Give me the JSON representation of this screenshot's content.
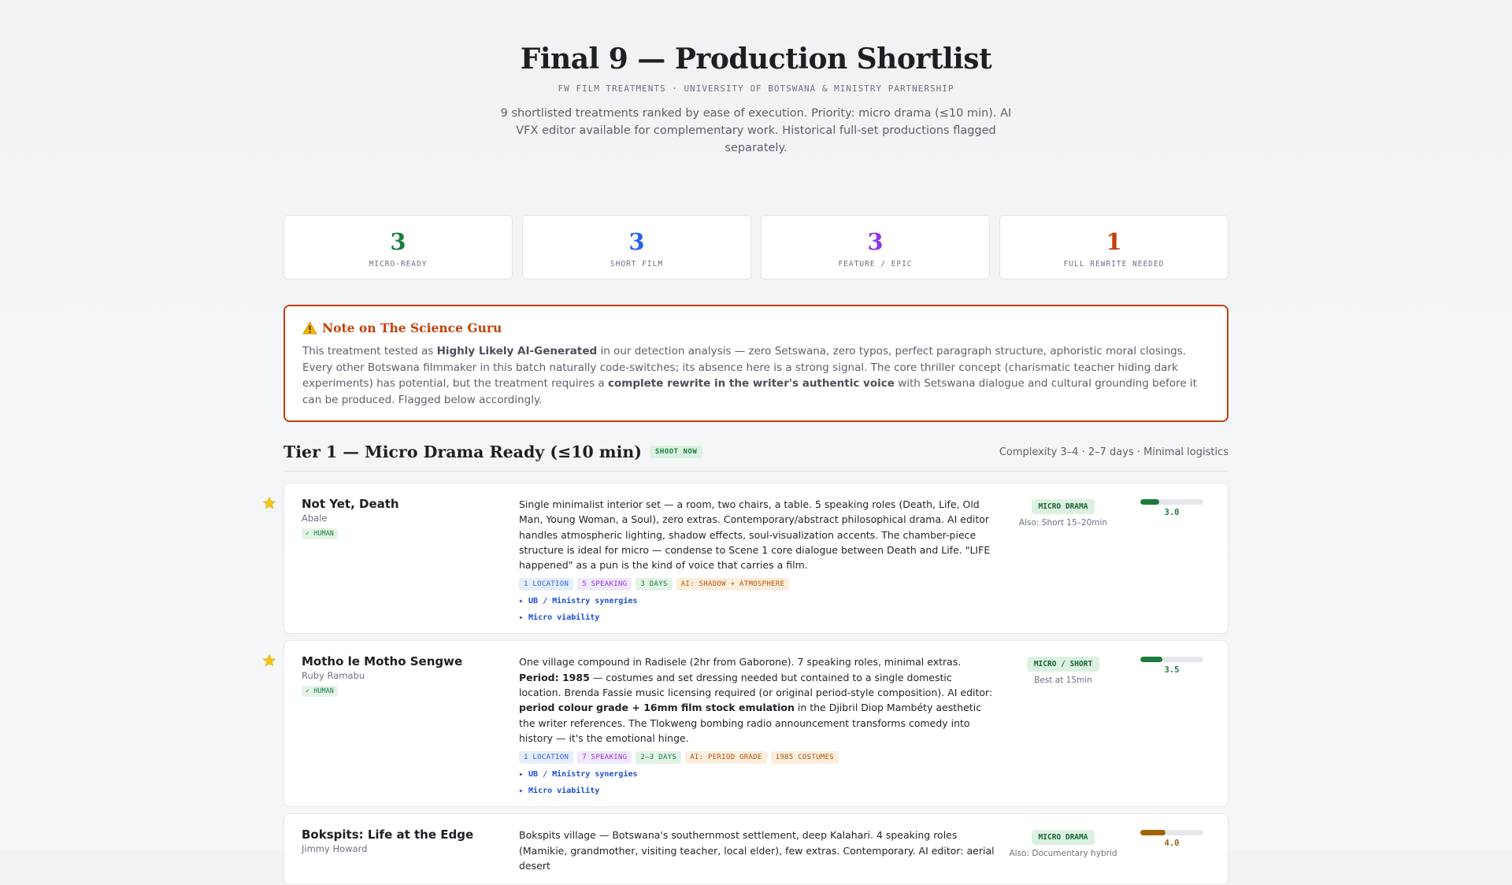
{
  "header": {
    "title": "Final 9 — Production Shortlist",
    "subtitle": "FW FILM TREATMENTS · UNIVERSITY OF BOTSWANA & MINISTRY PARTNERSHIP",
    "intro": "9 shortlisted treatments ranked by ease of execution. Priority: micro drama (≤10 min). AI VFX editor available for complementary work. Historical full-set productions flagged separately."
  },
  "stats": [
    {
      "value": "3",
      "label": "MICRO-READY",
      "color": "#15803d"
    },
    {
      "value": "3",
      "label": "SHORT FILM",
      "color": "#2563eb"
    },
    {
      "value": "3",
      "label": "FEATURE / EPIC",
      "color": "#9333ea"
    },
    {
      "value": "1",
      "label": "FULL REWRITE NEEDED",
      "color": "#c2410c"
    }
  ],
  "note": {
    "icon": "warning-icon",
    "title": "Note on The Science Guru",
    "p1": "This treatment tested as ",
    "b1": "Highly Likely AI-Generated",
    "p2": " in our detection analysis — zero Setswana, zero typos, perfect paragraph structure, aphoristic moral closings. Every other Botswana filmmaker in this batch naturally code-switches; its absence here is a strong signal. The core thriller concept (charismatic teacher hiding dark experiments) has potential, but the treatment requires a ",
    "b2": "complete rewrite in the writer's authentic voice",
    "p3": " with Setswana dialogue and cultural grounding before it can be produced. Flagged below accordingly."
  },
  "tier1": {
    "title": "Tier 1 — Micro Drama Ready (≤10 min)",
    "badge": "SHOOT NOW",
    "meta": "Complexity 3–4 · 2–7 days · Minimal logistics"
  },
  "cards": [
    {
      "starred": true,
      "title": "Not Yet, Death",
      "author": "Abale",
      "human": "✓ HUMAN",
      "desc": [
        {
          "t": "Single minimalist interior set — a room, two chairs, a table. 5 speaking roles (Death, Life, Old Man, Young Woman, a Soul), zero extras. Contemporary/abstract philosophical drama. AI editor handles atmospheric lighting, shadow effects, soul-visualization accents. The chamber-piece structure is ideal for micro — condense to Scene 1 core dialogue between Death and Life. \"LIFE happened\" as a pun is the kind of voice that carries a film.",
          "b": false
        }
      ],
      "tags": [
        {
          "text": "1 LOCATION",
          "cls": "t-blue"
        },
        {
          "text": "5 SPEAKING",
          "cls": "t-purple"
        },
        {
          "text": "3 DAYS",
          "cls": "t-green"
        },
        {
          "text": "AI: SHADOW + ATMOSPHERE",
          "cls": "t-orange"
        }
      ],
      "links": [
        "▸ UB / Ministry synergies",
        "▸ Micro viability"
      ],
      "type": "MICRO DRAMA",
      "type_sub": "Also: Short 15–20min",
      "score": "3.0",
      "score_pct": 0.3,
      "score_color": "#1e7a3c"
    },
    {
      "starred": true,
      "title": "Motho le Motho Sengwe",
      "author": "Ruby Ramabu",
      "human": "✓ HUMAN",
      "desc": [
        {
          "t": "One village compound in Radisele (2hr from Gaborone). 7 speaking roles, minimal extras. ",
          "b": false
        },
        {
          "t": "Period: 1985",
          "b": true
        },
        {
          "t": " — costumes and set dressing needed but contained to a single domestic location. Brenda Fassie music licensing required (or original period-style composition). AI editor: ",
          "b": false
        },
        {
          "t": "period colour grade + 16mm film stock emulation",
          "b": true
        },
        {
          "t": " in the Djibril Diop Mambéty aesthetic the writer references. The Tlokweng bombing radio announcement transforms comedy into history — it's the emotional hinge.",
          "b": false
        }
      ],
      "tags": [
        {
          "text": "1 LOCATION",
          "cls": "t-blue"
        },
        {
          "text": "7 SPEAKING",
          "cls": "t-purple"
        },
        {
          "text": "2–3 DAYS",
          "cls": "t-green"
        },
        {
          "text": "AI: PERIOD GRADE",
          "cls": "t-orange"
        },
        {
          "text": "1985 COSTUMES",
          "cls": "t-orange"
        }
      ],
      "links": [
        "▸ UB / Ministry synergies",
        "▸ Micro viability"
      ],
      "type": "MICRO / SHORT",
      "type_sub": "Best at 15min",
      "score": "3.5",
      "score_pct": 0.35,
      "score_color": "#1e7a3c"
    },
    {
      "starred": false,
      "title": "Bokspits: Life at the Edge",
      "author": "Jimmy Howard",
      "human": "",
      "desc": [
        {
          "t": "Bokspits village — Botswana's southernmost settlement, deep Kalahari. 4 speaking roles (Mamikie, grandmother, visiting teacher, local elder), few extras. Contemporary. AI editor: aerial desert",
          "b": false
        }
      ],
      "tags": [],
      "links": [],
      "type": "MICRO DRAMA",
      "type_sub": "Also: Documentary hybrid",
      "score": "4.0",
      "score_pct": 0.4,
      "score_color": "#a16207"
    }
  ]
}
